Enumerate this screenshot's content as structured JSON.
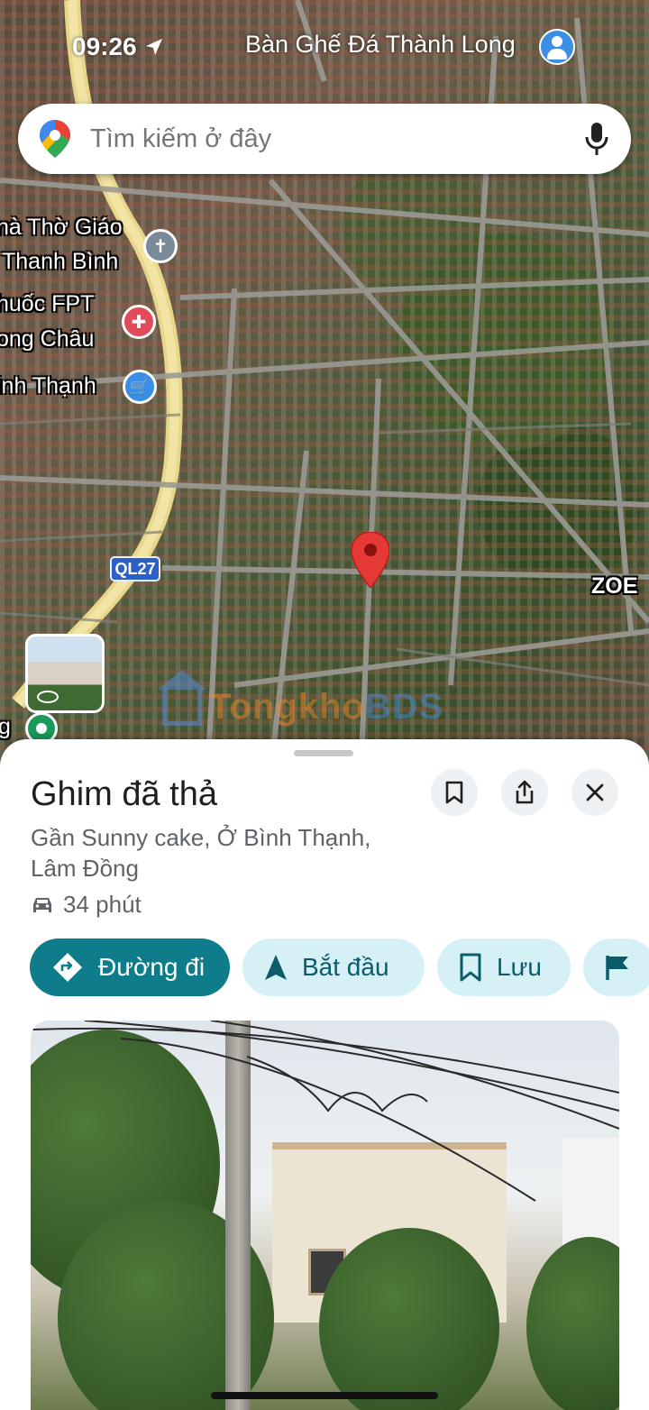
{
  "status_bar": {
    "time": "09:26",
    "place_label": "Bàn Ghế Đá Thành Long"
  },
  "search": {
    "placeholder": "Tìm kiếm ở đây"
  },
  "map": {
    "labels": {
      "church_line1": "nà Thờ Giáo",
      "church_line2": "Thanh Bình",
      "pharmacy_line1": "huốc FPT",
      "pharmacy_line2": "ong Châu",
      "shop_line1": "inh Thạnh",
      "zoe": "ZOE",
      "bottom_left": "g"
    },
    "route_badge": "QL27",
    "watermark": {
      "part1": "Tongkho",
      "part2": "BDS"
    }
  },
  "place": {
    "title": "Ghim đã thả",
    "address_line1": "Gần Sunny cake, Ở Bình Thạnh,",
    "address_line2": "Lâm Đồng",
    "drive_time": "34 phút"
  },
  "actions": {
    "directions": "Đường đi",
    "start": "Bắt đầu",
    "save": "Lưu"
  },
  "colors": {
    "primary_teal": "#0e7c8a",
    "chip_bg": "#d6f1f6",
    "pin_red": "#e53935"
  }
}
